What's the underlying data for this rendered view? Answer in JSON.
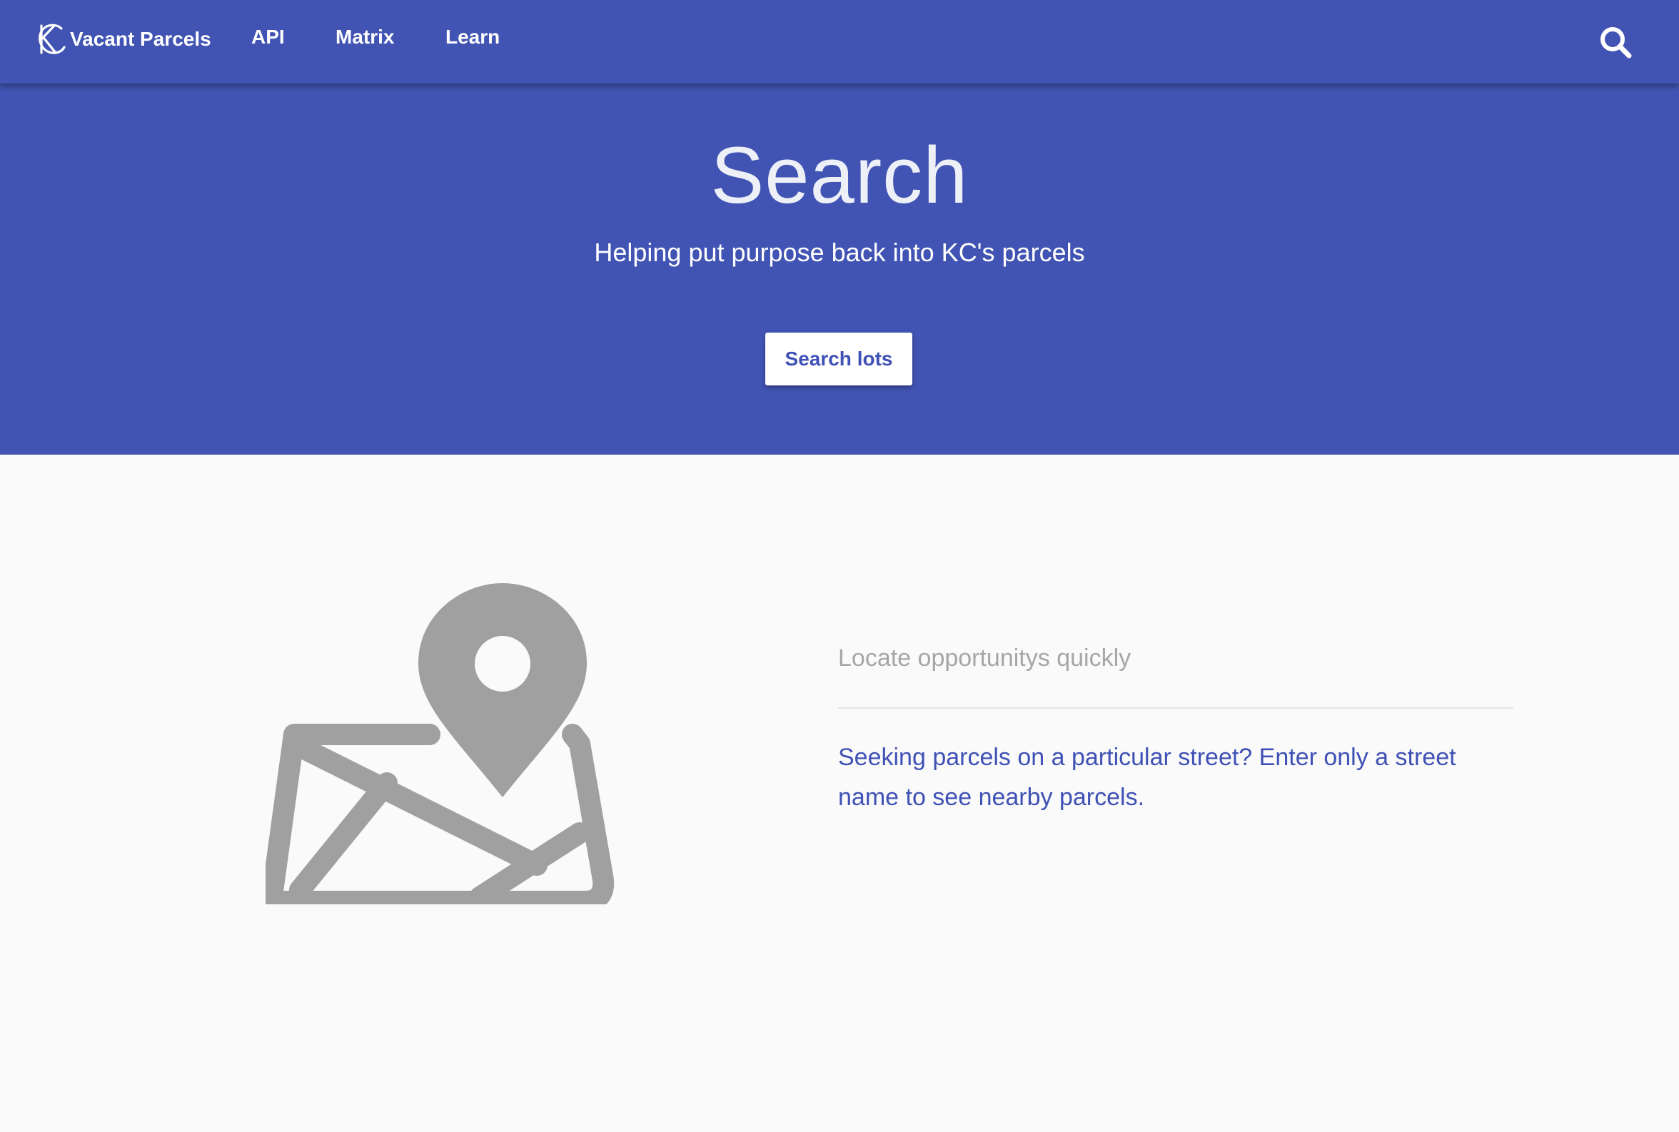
{
  "navbar": {
    "brand": "Vacant Parcels",
    "brand_logo_icon": "kc-logo-icon",
    "links": [
      "API",
      "Matrix",
      "Learn"
    ],
    "search_icon": "search-icon",
    "background": "#4154b3"
  },
  "hero": {
    "title": "Search",
    "subtitle": "Helping put purpose back into KC's parcels",
    "button_label": "Search lots",
    "background": "#4154b3",
    "button_text_color": "#3f51b5"
  },
  "feature": {
    "icon": "map-pin-icon",
    "heading": "Locate opportunitys quickly",
    "description": "Seeking parcels on a particular street? Enter only a street name to see nearby parcels.",
    "heading_color": "#a6a6a6",
    "text_color": "#3f51b5",
    "icon_color": "#a0a0a0"
  }
}
